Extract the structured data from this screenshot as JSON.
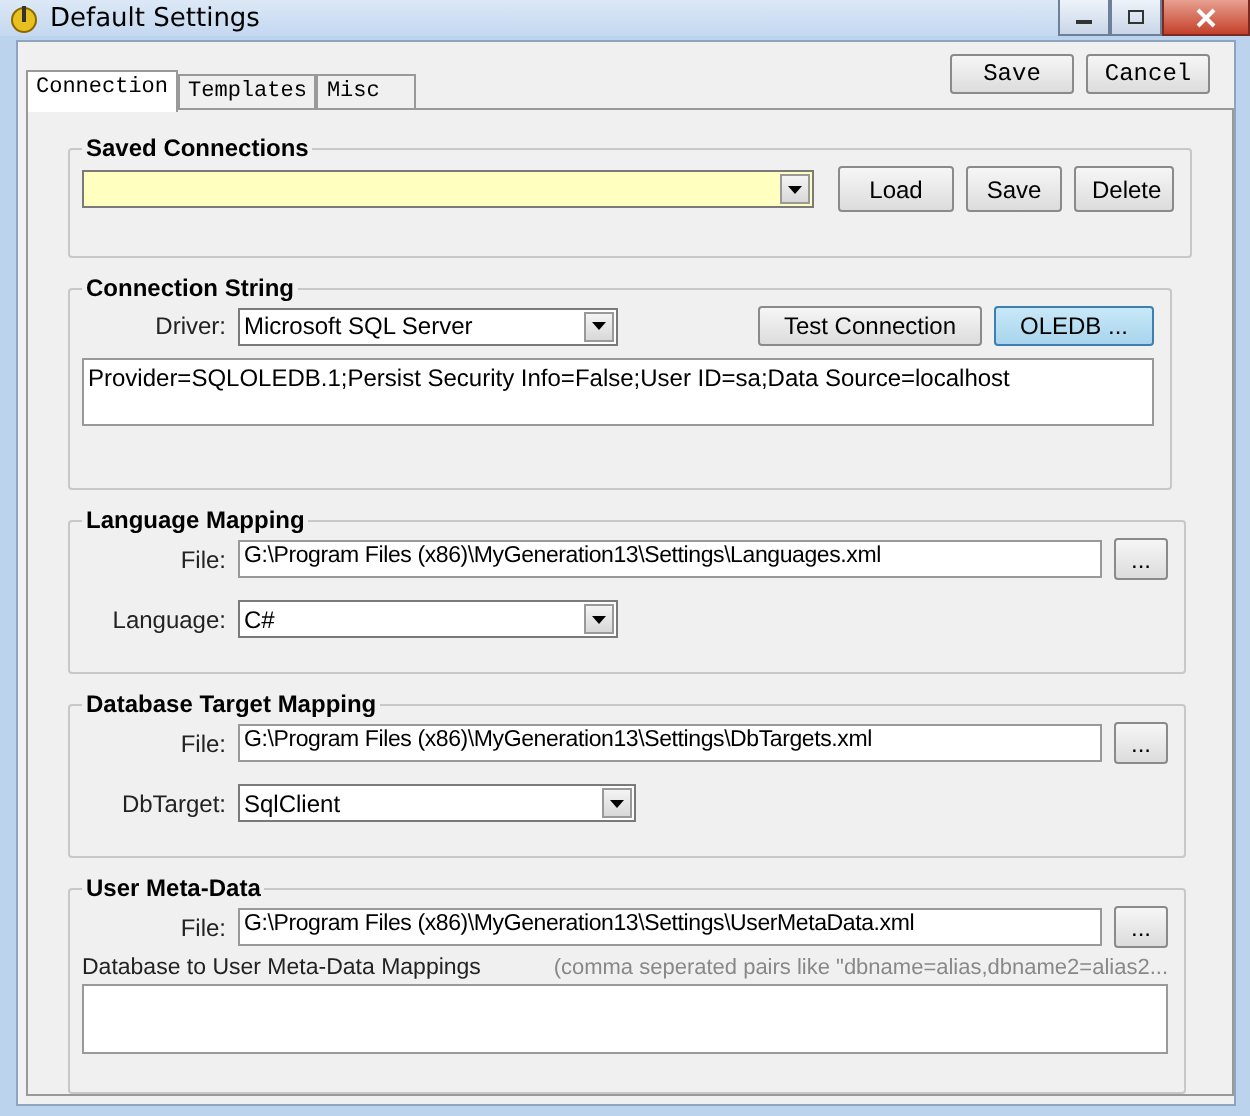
{
  "window": {
    "title": "Default Settings"
  },
  "tabs": [
    {
      "label": "Connection",
      "selected": true
    },
    {
      "label": "Templates",
      "selected": false
    },
    {
      "label": "Misc",
      "selected": false
    }
  ],
  "dialog_buttons": [
    "Save",
    "Cancel"
  ],
  "saved_connections": {
    "title": "Saved Connections",
    "buttons": [
      "Load",
      "Save",
      "Delete"
    ]
  },
  "connection_string": {
    "title": "Connection String",
    "driver_label": "Driver:",
    "driver": "Microsoft SQL Server",
    "buttons": [
      {
        "label": "Test Connection",
        "highlighted": false
      },
      {
        "label": "OLEDB ...",
        "highlighted": true
      }
    ],
    "value": "Provider=SQLOLEDB.1;Persist Security Info=False;User ID=sa;Data Source=localhost"
  },
  "language_mapping": {
    "title": "Language Mapping",
    "file_label": "File:",
    "file": "G:\\Program Files (x86)\\MyGeneration13\\Settings\\Languages.xml",
    "browse": "...",
    "language_label": "Language:",
    "language": "C#"
  },
  "database_target_mapping": {
    "title": "Database Target Mapping",
    "file_label": "File:",
    "file": "G:\\Program Files (x86)\\MyGeneration13\\Settings\\DbTargets.xml",
    "browse": "...",
    "dbtarget_label": "DbTarget:",
    "dbtarget": "SqlClient"
  },
  "user_meta_data": {
    "title": "User Meta-Data",
    "file_label": "File:",
    "file": "G:\\Program Files (x86)\\MyGeneration13\\Settings\\UserMetaData.xml",
    "browse": "...",
    "mappings_label": "Database to User Meta-Data Mappings",
    "mappings_hint": "(comma seperated pairs like \"dbname=alias,dbname2=alias2..."
  }
}
